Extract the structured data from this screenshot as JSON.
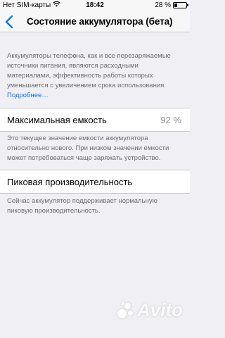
{
  "status_bar": {
    "carrier": "Нет SIM-карты",
    "time": "18:42",
    "battery_percent": "28 %",
    "battery_level": 0.28
  },
  "nav": {
    "title": "Состояние аккумулятора (бета)"
  },
  "info": {
    "text": "Аккумуляторы телефона, как и все перезаряжаемые источники питания, являются расходными материалами, эффективность работы которых уменьшается с увеличением срока использования.",
    "more_link": "Подробнее…"
  },
  "max_capacity": {
    "label": "Максимальная емкость",
    "value": "92 %",
    "footer": "Это текущее значение емкости аккумулятора относительно нового. При низком значении емкости может потребоваться чаще заряжать устройство."
  },
  "peak_performance": {
    "label": "Пиковая производительность",
    "footer": "Сейчас аккумулятор поддерживает нормальную пиковую производительность."
  },
  "watermark": {
    "text": "Avito"
  }
}
